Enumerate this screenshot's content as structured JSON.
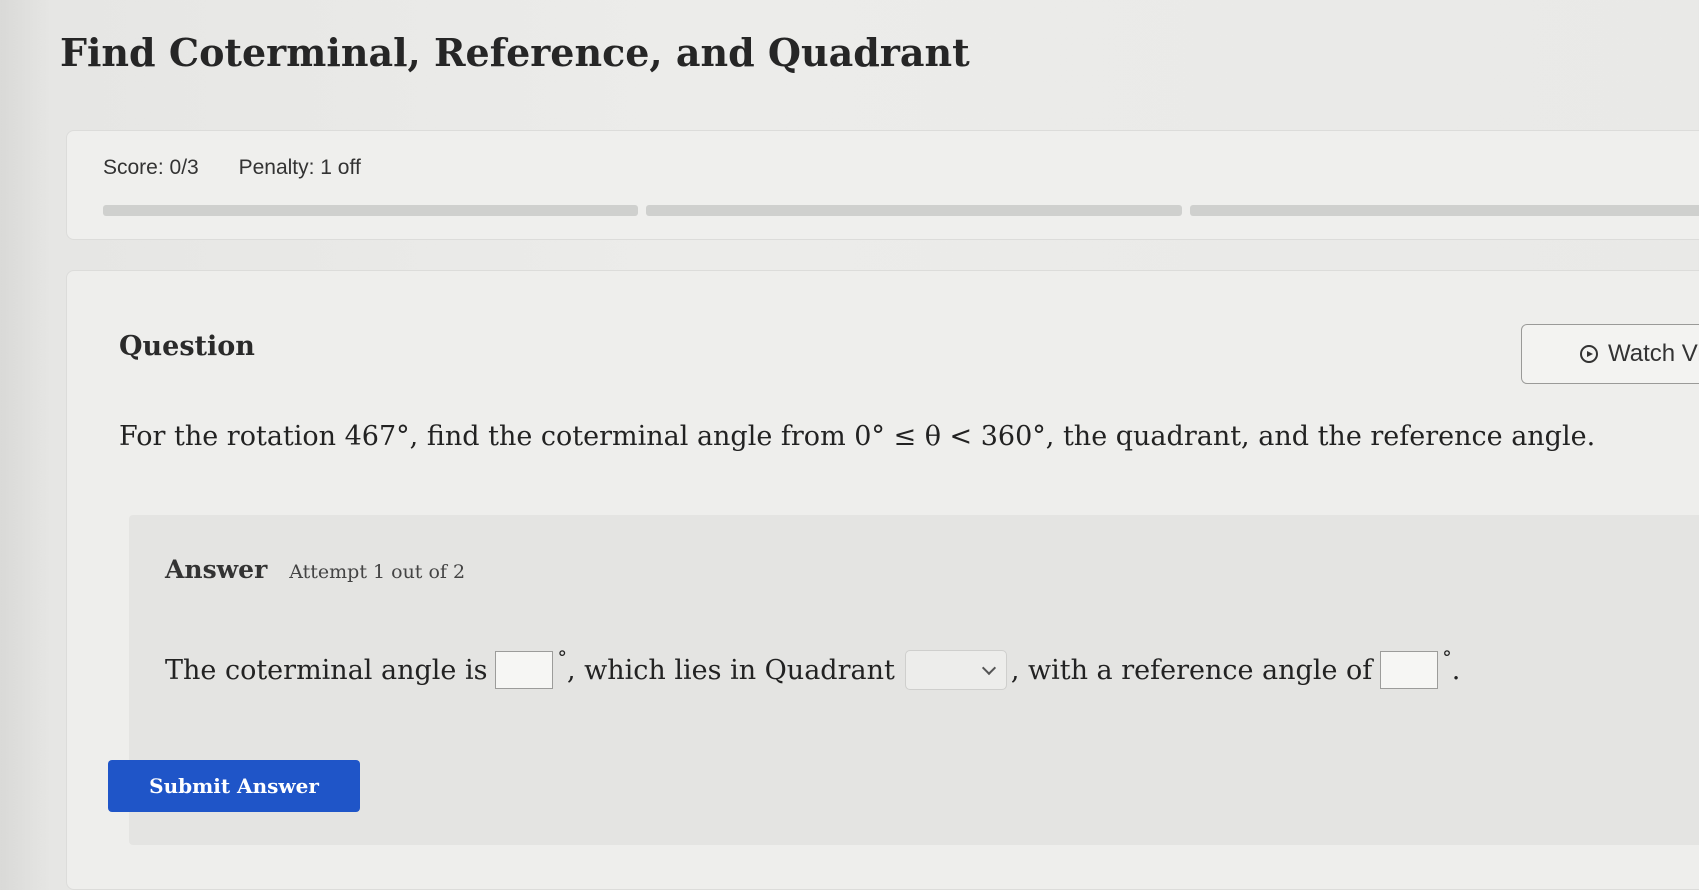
{
  "page": {
    "title": "Find Coterminal, Reference, and Quadrant"
  },
  "score": {
    "score_text": "Score: 0/3",
    "penalty_text": "Penalty: 1 off",
    "segments": 3
  },
  "question": {
    "heading": "Question",
    "watch_label": "Watch Vi",
    "text": "For the rotation 467°, find the coterminal angle from 0° ≤ θ < 360°, the quadrant, and the reference angle."
  },
  "answer": {
    "label": "Answer",
    "attempt": "Attempt 1 out of 2",
    "part1": "The coterminal angle is",
    "degree": "°",
    "part2": ", which lies in Quadrant",
    "part3": ", with a reference angle of",
    "end": ".",
    "coterminal_value": "",
    "quadrant_selected": "",
    "reference_value": ""
  },
  "submit": {
    "label": "Submit Answer",
    "color": "#1f55c8"
  }
}
